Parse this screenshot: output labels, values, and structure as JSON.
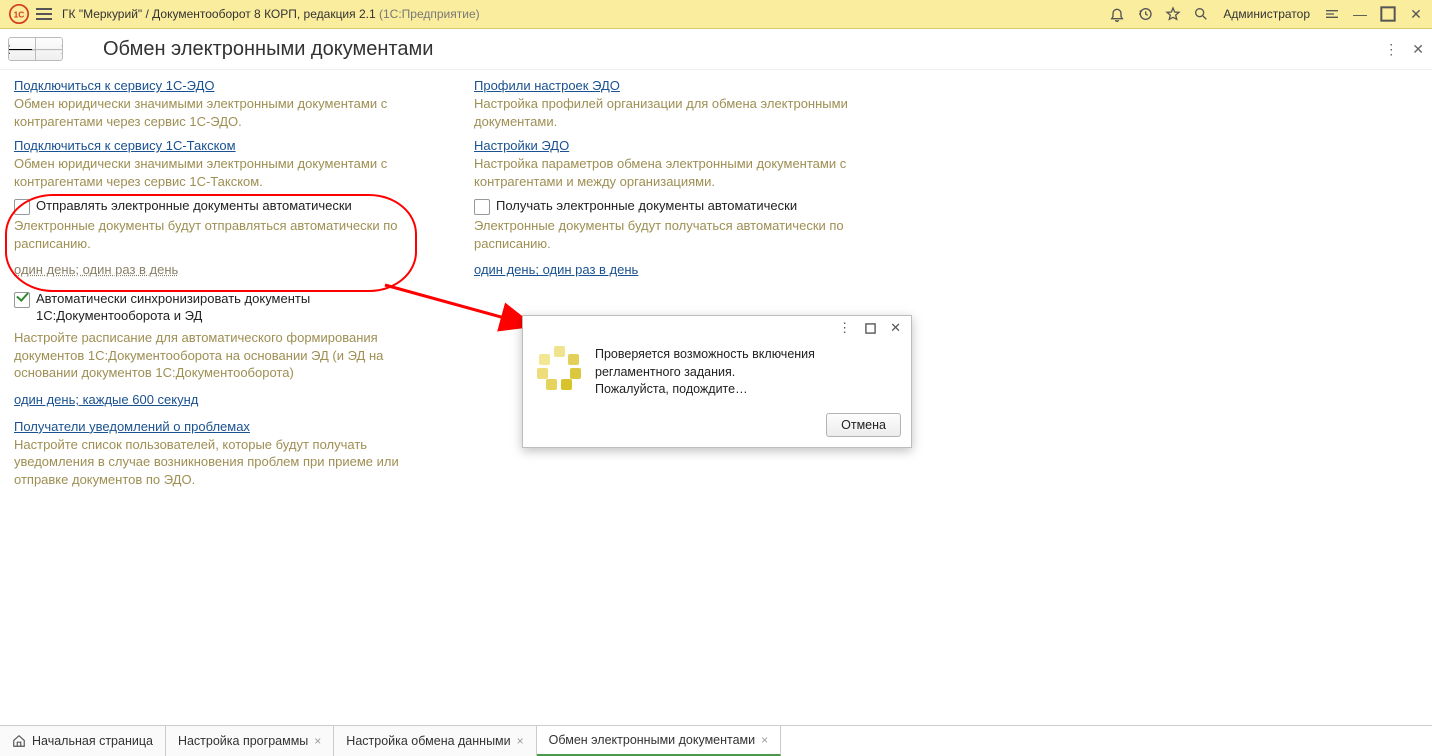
{
  "titlebar": {
    "primary": "ГК \"Меркурий\" / Документооборот 8 КОРП, редакция 2.1",
    "secondary": "(1С:Предприятие)",
    "user": "Администратор"
  },
  "page": {
    "title": "Обмен электронными документами"
  },
  "left": {
    "connect_edo": {
      "link": "Подключиться к сервису 1С-ЭДО",
      "desc": "Обмен юридически значимыми электронными документами с контрагентами через сервис 1С-ЭДО."
    },
    "connect_taxcom": {
      "link": "Подключиться к сервису 1С-Такском",
      "desc": "Обмен юридически значимыми электронными документами с контрагентами через сервис 1С-Такском."
    },
    "send_auto": {
      "label": "Отправлять электронные документы автоматически",
      "desc": "Электронные документы будут отправляться автоматически по расписанию.",
      "schedule": "один день; один раз в день"
    },
    "sync": {
      "label": "Автоматически синхронизировать документы",
      "label2": "1С:Документооборота и ЭД",
      "desc": "Настройте расписание для автоматического формирования документов 1С:Документооборота на основании ЭД (и ЭД на основании документов 1С:Документооборота)",
      "schedule": "один день; каждые 600 секунд"
    },
    "recipients": {
      "link": "Получатели уведомлений о проблемах",
      "desc": "Настройте список пользователей, которые будут получать уведомления в случае возникновения проблем при приеме или отправке документов по ЭДО."
    }
  },
  "right": {
    "profiles": {
      "link": "Профили настроек ЭДО",
      "desc": "Настройка профилей организации для обмена электронными документами."
    },
    "settings": {
      "link": "Настройки ЭДО",
      "desc": "Настройка параметров обмена электронными документами с контрагентами и между организациями."
    },
    "recv_auto": {
      "label": "Получать электронные документы автоматически",
      "desc": "Электронные документы будут получаться автоматически по расписанию.",
      "schedule": "один день; один раз в день"
    }
  },
  "modal": {
    "line1": "Проверяется возможность включения",
    "line2": "регламентного задания.",
    "line3": "Пожалуйста, подождите…",
    "cancel": "Отмена"
  },
  "tabs": {
    "home": "Начальная страница",
    "t1": "Настройка программы",
    "t2": "Настройка обмена данными",
    "t3": "Обмен электронными документами"
  }
}
